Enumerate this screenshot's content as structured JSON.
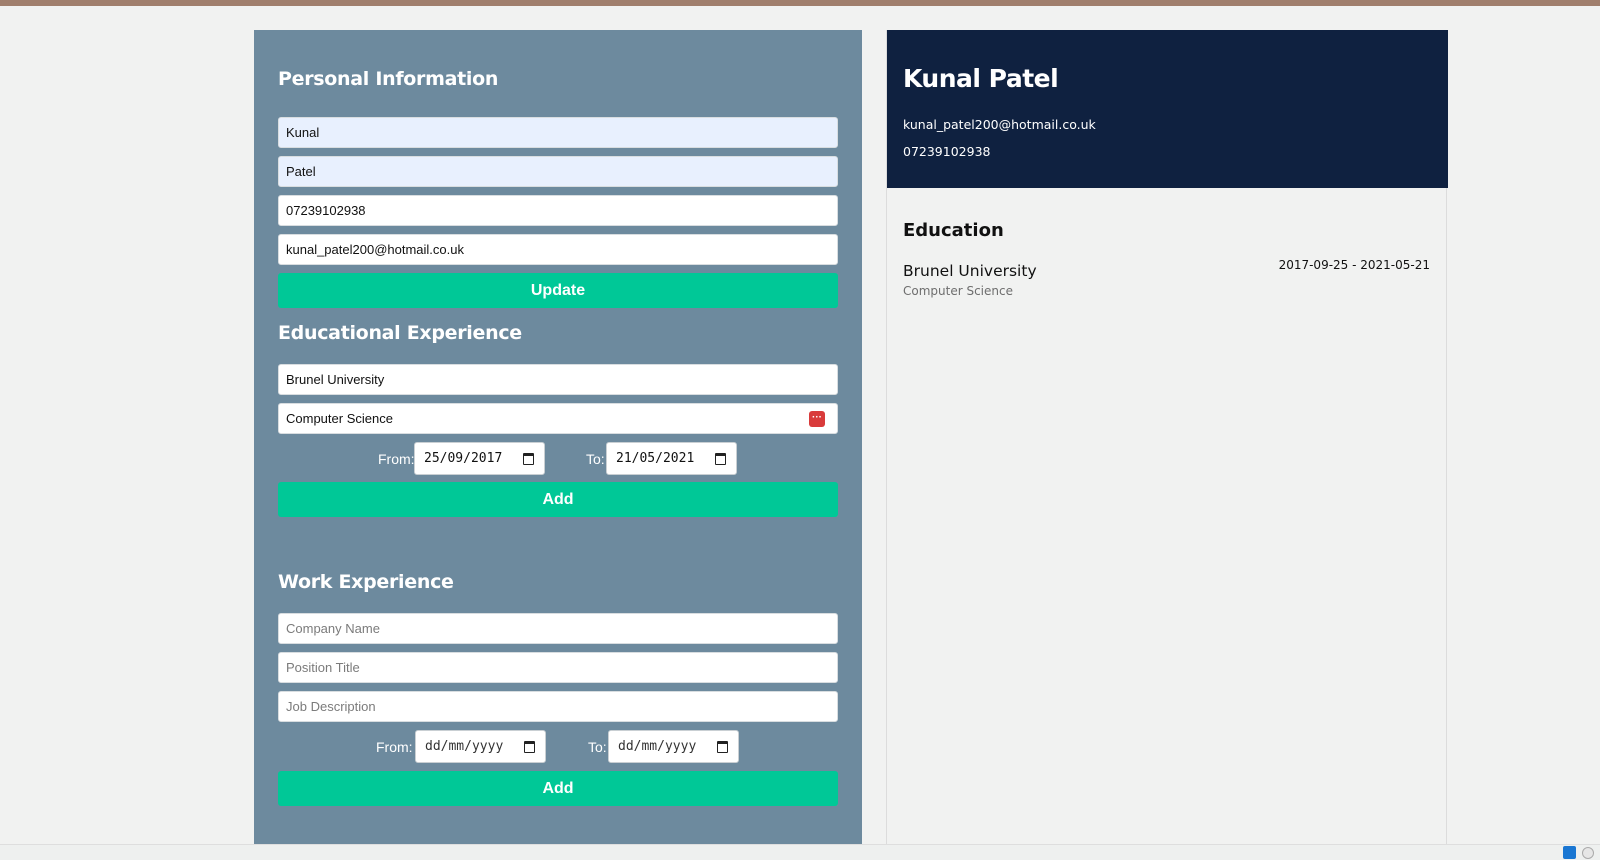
{
  "form": {
    "personal": {
      "title": "Personal Information",
      "first_name": "Kunal",
      "last_name": "Patel",
      "phone": "07239102938",
      "email": "kunal_patel200@hotmail.co.uk",
      "button": "Update"
    },
    "education": {
      "title": "Educational Experience",
      "school": "Brunel University",
      "subject": "Computer Science",
      "from_label": "From:",
      "from_value": "25/09/2017",
      "to_label": "To:",
      "to_value": "21/05/2021",
      "button": "Add"
    },
    "work": {
      "title": "Work Experience",
      "company_placeholder": "Company Name",
      "position_placeholder": "Position Title",
      "description_placeholder": "Job Description",
      "from_label": "From:",
      "from_value": "dd/mm/yyyy",
      "to_label": "To:",
      "to_value": "dd/mm/yyyy",
      "button": "Add"
    }
  },
  "preview": {
    "name": "Kunal Patel",
    "email": "kunal_patel200@hotmail.co.uk",
    "phone": "07239102938",
    "education_title": "Education",
    "education_items": [
      {
        "school": "Brunel University",
        "subject": "Computer Science",
        "dates": "2017-09-25 - 2021-05-21"
      }
    ]
  },
  "colors": {
    "form_bg": "#6d8a9e",
    "button": "#00c897",
    "header_bg": "#0f2140"
  },
  "icons": [
    "calendar-icon",
    "password-manager-icon"
  ]
}
